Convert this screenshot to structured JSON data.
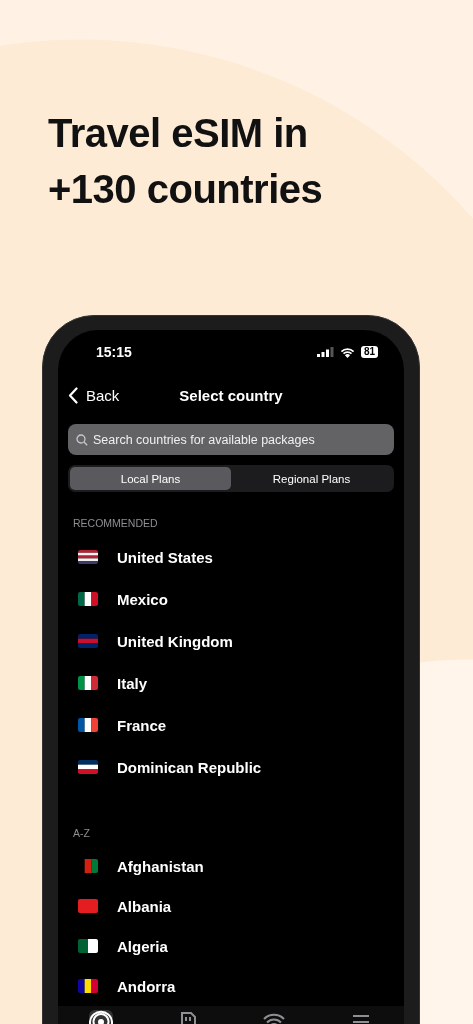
{
  "headline": "Travel eSIM in +130 countries",
  "status_bar": {
    "time": "15:15",
    "battery": "81"
  },
  "nav": {
    "back": "Back",
    "title": "Select country"
  },
  "search": {
    "placeholder": "Search countries for available packages"
  },
  "segments": [
    {
      "label": "Local Plans",
      "selected": true
    },
    {
      "label": "Regional Plans",
      "selected": false
    }
  ],
  "sections": [
    {
      "title": "RECOMMENDED",
      "countries": [
        {
          "name": "United States"
        },
        {
          "name": "Mexico"
        },
        {
          "name": "United Kingdom"
        },
        {
          "name": "Italy"
        },
        {
          "name": "France"
        },
        {
          "name": "Dominican Republic"
        }
      ]
    },
    {
      "title": "A-Z",
      "countries": [
        {
          "name": "Afghanistan"
        },
        {
          "name": "Albania"
        },
        {
          "name": "Algeria"
        },
        {
          "name": "Andorra"
        }
      ]
    }
  ],
  "tab_bar": [
    {
      "selected": true
    },
    {
      "selected": false
    },
    {
      "selected": false
    },
    {
      "selected": false
    }
  ]
}
